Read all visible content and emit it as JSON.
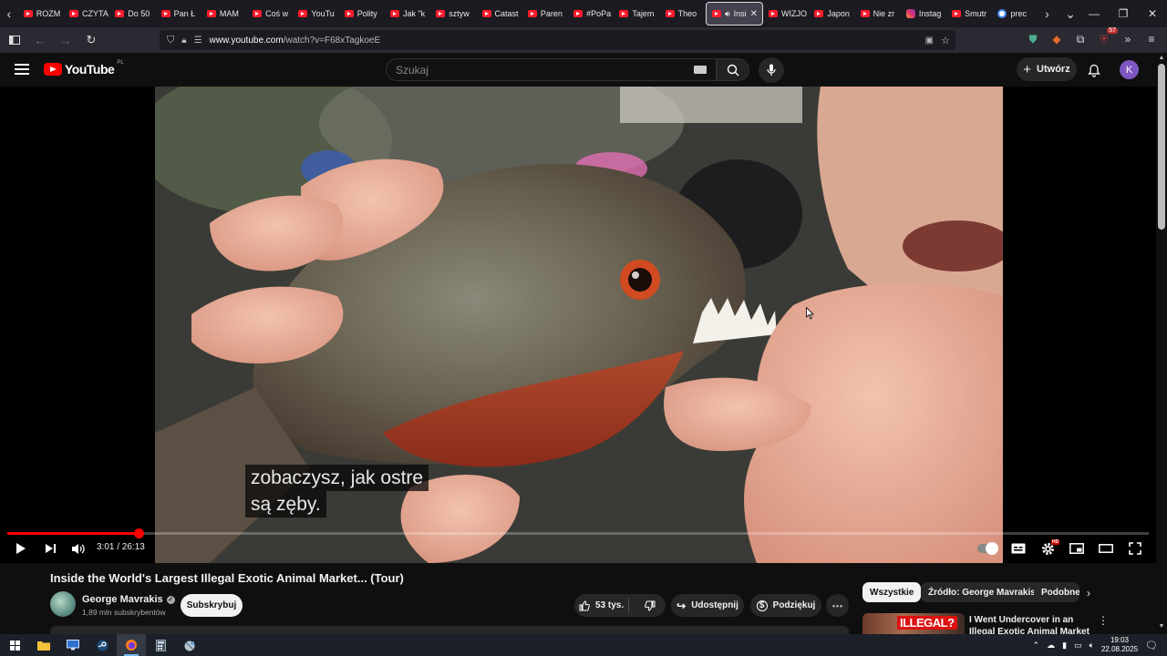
{
  "browser": {
    "tabs": [
      {
        "label": "ROZM",
        "kind": "yt"
      },
      {
        "label": "CZYTA",
        "kind": "yt"
      },
      {
        "label": "Do 50",
        "kind": "yt"
      },
      {
        "label": "Pan Ł",
        "kind": "yt"
      },
      {
        "label": "MAM",
        "kind": "yt"
      },
      {
        "label": "Coś w",
        "kind": "yt"
      },
      {
        "label": "YouTu",
        "kind": "yt"
      },
      {
        "label": "Polity",
        "kind": "yt"
      },
      {
        "label": "Jak \"k",
        "kind": "yt"
      },
      {
        "label": "sztyw",
        "kind": "yt"
      },
      {
        "label": "Catast",
        "kind": "yt"
      },
      {
        "label": "Paren",
        "kind": "yt"
      },
      {
        "label": "#PoPa",
        "kind": "yt"
      },
      {
        "label": "Tajem",
        "kind": "yt"
      },
      {
        "label": "Theo",
        "kind": "yt"
      },
      {
        "label": "Insi",
        "kind": "yt",
        "active": true
      },
      {
        "label": "WIZJO",
        "kind": "yt"
      },
      {
        "label": "Japon",
        "kind": "yt"
      },
      {
        "label": "Nie zr",
        "kind": "yt"
      },
      {
        "label": "Instag",
        "kind": "insta"
      },
      {
        "label": "Smutr",
        "kind": "yt"
      },
      {
        "label": "prec",
        "kind": "google"
      }
    ],
    "url_host": "www.youtube.com",
    "url_path": "/watch?v=F68xTagkoeE",
    "extension_badge": "57"
  },
  "youtube": {
    "logo_text": "YouTube",
    "country_code": "PL",
    "search_placeholder": "Szukaj",
    "create_label": "Utwórz",
    "avatar_letter": "K"
  },
  "player": {
    "subtitle_line1": "zobaczysz, jak ostre",
    "subtitle_line2": "są zęby.",
    "current_time": "3:01",
    "duration": "26:13",
    "time_display": "3:01 / 26:13",
    "played_fraction": 0.115,
    "buffered_fraction": 0.118,
    "hd_badge": "HD"
  },
  "video": {
    "title": "Inside the World's Largest Illegal Exotic Animal Market... (Tour)",
    "channel_name": "George Mavrakis",
    "subscribers": "1,89 mln subskrybentów",
    "subscribe_label": "Subskrybuj",
    "likes": "53 tys.",
    "share_label": "Udostępnij",
    "thanks_label": "Podziękuj"
  },
  "sidebar": {
    "chips": [
      "Wszystkie",
      "Źródło: George Mavrakis",
      "Podobne"
    ],
    "recommendation": {
      "thumb_text": "ILLEGAL?",
      "title": "I Went Undercover in an Illegal Exotic Animal Market"
    }
  },
  "taskbar": {
    "time": "19:03",
    "date": "22.08.2025"
  },
  "colors": {
    "yt_red": "#ff0000",
    "bg": "#0f0f0f",
    "browser_tabbar": "#1c1b22",
    "browser_toolbar": "#2b2a33",
    "taskbar": "#1c2029"
  }
}
